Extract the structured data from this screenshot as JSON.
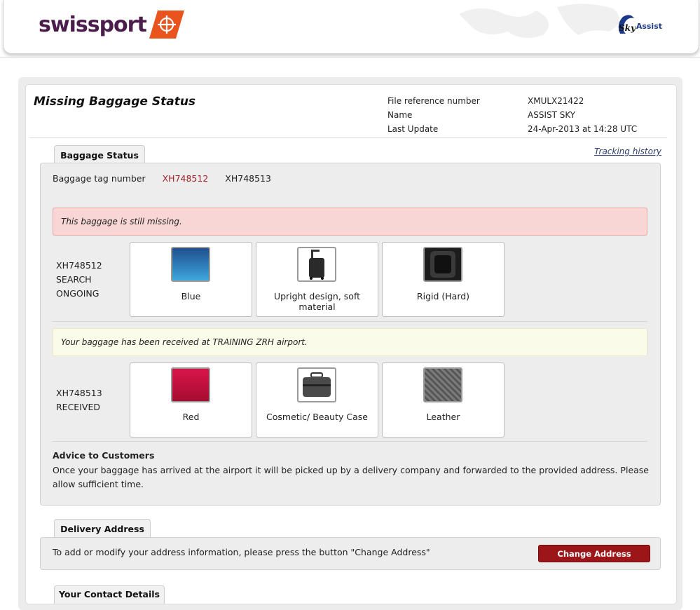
{
  "header": {
    "brand": "swissport",
    "partner_sky": "Sky",
    "partner_assist": "Assist"
  },
  "page": {
    "title": "Missing Baggage Status",
    "meta": [
      {
        "label": "File reference number",
        "value": "XMULX21422"
      },
      {
        "label": "Name",
        "value": "ASSIST SKY"
      },
      {
        "label": "Last Update",
        "value": "24-Apr-2013 at 14:28 UTC"
      }
    ]
  },
  "baggage_status": {
    "tab_label": "Baggage Status",
    "tracking_link": "Tracking history",
    "tag_label": "Baggage tag number",
    "tags": [
      "XH748512",
      "XH748513"
    ],
    "items": [
      {
        "message": "This baggage is still missing.",
        "status_lines": [
          "XH748512",
          "SEARCH",
          "ONGOING"
        ],
        "attributes": [
          {
            "caption": "Blue",
            "icon": "blue-color-swatch"
          },
          {
            "caption": "Upright design, soft material",
            "icon": "upright-suitcase-icon"
          },
          {
            "caption": "Rigid (Hard)",
            "icon": "rigid-material-icon"
          }
        ]
      },
      {
        "message": "Your baggage has been received at TRAINING ZRH airport.",
        "status_lines": [
          "XH748513",
          "RECEIVED"
        ],
        "attributes": [
          {
            "caption": "Red",
            "icon": "red-color-swatch"
          },
          {
            "caption": "Cosmetic/ Beauty Case",
            "icon": "beauty-case-icon"
          },
          {
            "caption": "Leather",
            "icon": "leather-material-icon"
          }
        ]
      }
    ],
    "advice_title": "Advice to Customers",
    "advice_text": "Once your baggage has arrived at the airport it will be picked up by a delivery company and forwarded to the provided address. Please allow sufficient time."
  },
  "delivery": {
    "tab_label": "Delivery Address",
    "text": "To add or modify your address information, please press the button \"Change Address\"",
    "button": "Change Address"
  },
  "contact": {
    "tab_label": "Your Contact Details"
  },
  "colors": {
    "brand_purple": "#4a1d4a",
    "brand_orange": "#e8531e",
    "button_red": "#9c1518",
    "tag_active": "#a01f26"
  }
}
